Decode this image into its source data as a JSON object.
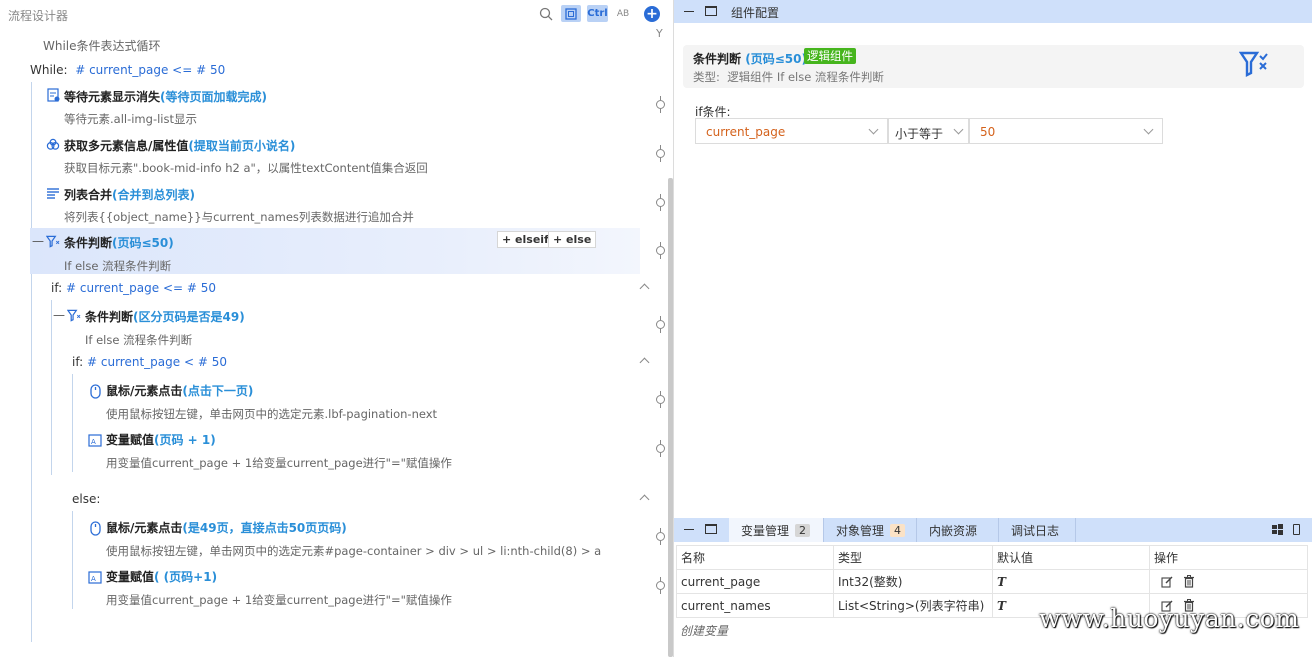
{
  "left": {
    "title": "流程设计器",
    "header_icons": [
      "search-icon",
      "frame-icon",
      "ctrl-icon",
      "spellcheck-icon",
      "add-icon"
    ],
    "ctrl_label": "Ctrl",
    "ab_label": "AB",
    "while_desc": "While条件表达式循环",
    "while_label": "While:",
    "while_expr": "# current_page <= # 50",
    "steps": [
      {
        "title": "等待元素显示消失",
        "note": "(等待页面加载完成)",
        "desc": "等待元素.all-img-list显示",
        "icon": "wait-icon"
      },
      {
        "title": "获取多元素信息/属性值",
        "note": "(提取当前页小说名)",
        "desc": "获取目标元素\".book-mid-info h2 a\"，以属性textContent值集合返回",
        "icon": "link-icon"
      },
      {
        "title": "列表合并",
        "note": "(合并到总列表)",
        "desc": "将列表{{object_name}}与current_names列表数据进行追加合并",
        "icon": "list-icon"
      },
      {
        "title": "条件判断",
        "note": "(页码≤50)",
        "desc": "If else 流程条件判断",
        "icon": "filter-icon"
      }
    ],
    "elseif_label": "+ elseif",
    "else_label": "+ else",
    "if1_label": "if:",
    "if1_expr": "# current_page <= # 50",
    "nested": {
      "title": "条件判断",
      "note": "(区分页码是否是49)",
      "desc": "If else 流程条件判断"
    },
    "if2_label": "if:",
    "if2_expr": "# current_page < # 50",
    "if2_steps": [
      {
        "title": "鼠标/元素点击",
        "note": "(点击下一页)",
        "desc": "使用鼠标按钮左键，单击网页中的选定元素.lbf-pagination-next",
        "icon": "mouse-icon"
      },
      {
        "title": "变量赋值",
        "note": "(页码 + 1)",
        "desc": "用变量值current_page + 1给变量current_page进行\"=\"赋值操作",
        "icon": "assign-icon"
      }
    ],
    "else_block_label": "else:",
    "else_steps": [
      {
        "title": "鼠标/元素点击",
        "note": "(是49页，直接点击50页页码)",
        "desc": "使用鼠标按钮左键，单击网页中的选定元素#page-container > div > ul > li:nth-child(8) > a",
        "icon": "mouse-icon"
      },
      {
        "title": "变量赋值",
        "note": "( (页码+1)",
        "desc": "用变量值current_page + 1给变量current_page进行\"=\"赋值操作",
        "icon": "assign-icon"
      }
    ]
  },
  "right": {
    "header_title": "组件配置",
    "card": {
      "title": "条件判断",
      "note": "(页码≤50)",
      "tag": "逻辑组件",
      "type_label": "类型:",
      "type_value": "逻辑组件 If else 流程条件判断"
    },
    "if_condition_label": "if条件:",
    "condition": {
      "left": "current_page",
      "op": "小于等于",
      "right": "50"
    }
  },
  "bottom": {
    "tabs": [
      {
        "label": "变量管理",
        "count": "2"
      },
      {
        "label": "对象管理",
        "count": "4"
      },
      {
        "label": "内嵌资源",
        "count": ""
      },
      {
        "label": "调试日志",
        "count": ""
      }
    ],
    "columns": [
      "名称",
      "类型",
      "默认值",
      "操作"
    ],
    "rows": [
      {
        "name": "current_page",
        "type": "Int32(整数)",
        "default": "T"
      },
      {
        "name": "current_names",
        "type": "List<String>(列表字符串)",
        "default": "T"
      }
    ],
    "create_label": "创建变量",
    "watermark": "www.huoyuyan.com"
  },
  "colors": {
    "accent": "#2a6cd6",
    "note": "#2a8fd8",
    "tag_green": "#46b51d",
    "condition_orange": "#d4621c",
    "header_blue": "#cfe0fa"
  }
}
